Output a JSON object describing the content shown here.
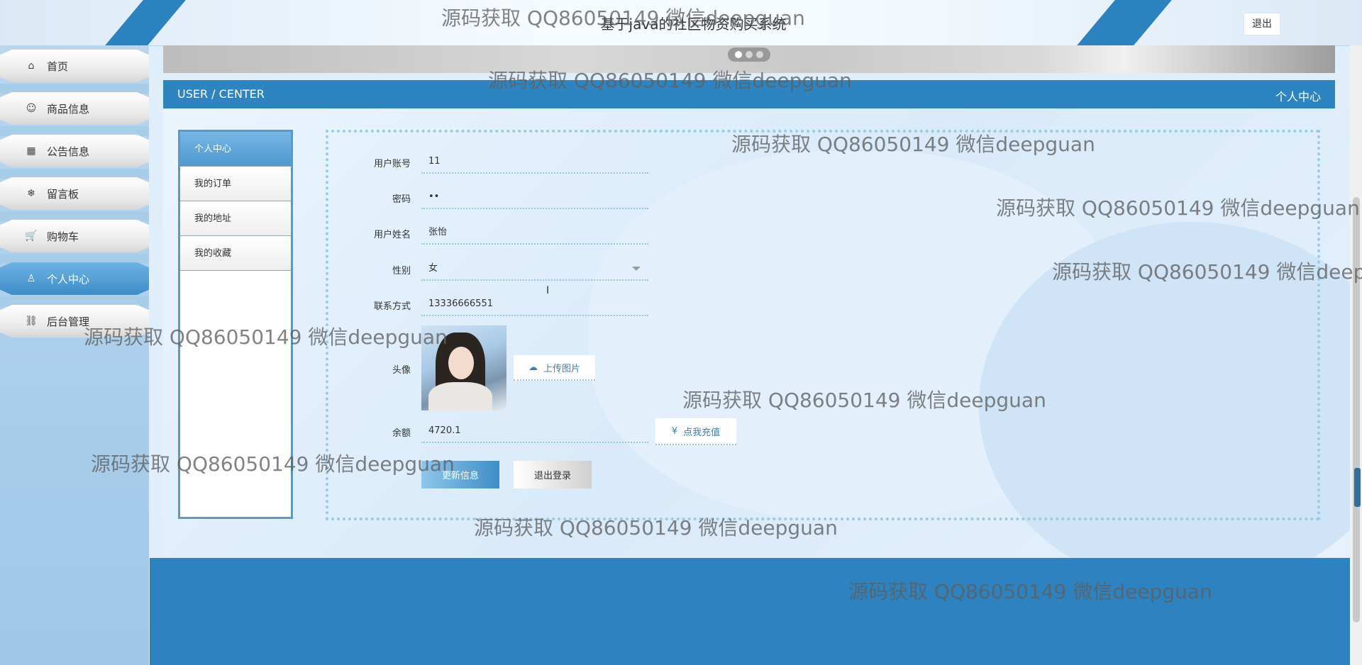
{
  "header": {
    "site_title": "基于java的社区物资购买系统",
    "logout_label": "退出"
  },
  "sidebar": {
    "items": [
      {
        "label": "首页",
        "icon": "⌂"
      },
      {
        "label": "商品信息",
        "icon": "☺"
      },
      {
        "label": "公告信息",
        "icon": "▦"
      },
      {
        "label": "留言板",
        "icon": "❄"
      },
      {
        "label": "购物车",
        "icon": "🛒"
      },
      {
        "label": "个人中心",
        "icon": "♙",
        "active": true
      },
      {
        "label": "后台管理",
        "icon": "⛓"
      }
    ]
  },
  "title_bar": {
    "en": "USER / CENTER",
    "cn": "个人中心"
  },
  "center_menu": {
    "items": [
      "个人中心",
      "我的订单",
      "我的地址",
      "我的收藏"
    ]
  },
  "form": {
    "account_label": "用户账号",
    "account_value": "11",
    "password_label": "密码",
    "password_value": "••",
    "name_label": "用户姓名",
    "name_value": "张怡",
    "gender_label": "性别",
    "gender_value": "女",
    "phone_label": "联系方式",
    "phone_value": "13336666551",
    "avatar_label": "头像",
    "upload_label": "上传图片",
    "balance_label": "余额",
    "balance_value": "4720.1",
    "recharge_label": "点我充值",
    "update_label": "更新信息",
    "logout_label": "退出登录"
  },
  "watermark": "源码获取 QQ86050149 微信deepguan",
  "colors": {
    "primary": "#2e84c0",
    "sidebar_bg": "#a7cde9",
    "footer": "#2d82bf",
    "dotted_border": "#98cbe4"
  }
}
